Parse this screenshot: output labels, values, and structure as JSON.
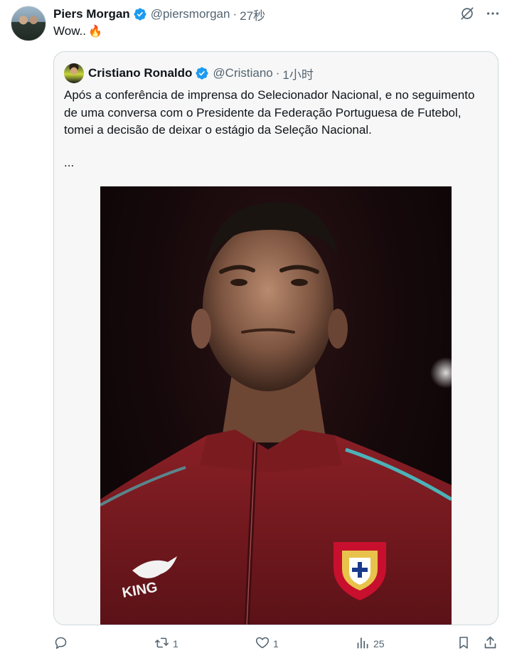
{
  "author": {
    "name": "Piers Morgan",
    "handle": "@piersmorgan",
    "separator": "·",
    "time": "27秒",
    "verified": true
  },
  "tweet_text": "Wow..",
  "tweet_emoji": "🔥",
  "quoted": {
    "name": "Cristiano Ronaldo",
    "handle": "@Cristiano",
    "separator": "·",
    "time": "1小时",
    "verified": true,
    "text": "Após a conferência de imprensa do Selecionador Nacional, e no seguimento de uma conversa com o Presidente da Federação Portuguesa de Futebol, tomei a decisão de deixar o estágio da Seleção Nacional.",
    "more": "...",
    "image": {
      "brand_text": "KING"
    }
  },
  "actions": {
    "reply_count": "",
    "retweet_count": "1",
    "like_count": "1",
    "views_count": "25"
  },
  "colors": {
    "verified_blue": "#1d9bf0",
    "secondary_text": "#536471",
    "jacket_red": "#7a1b1f"
  }
}
